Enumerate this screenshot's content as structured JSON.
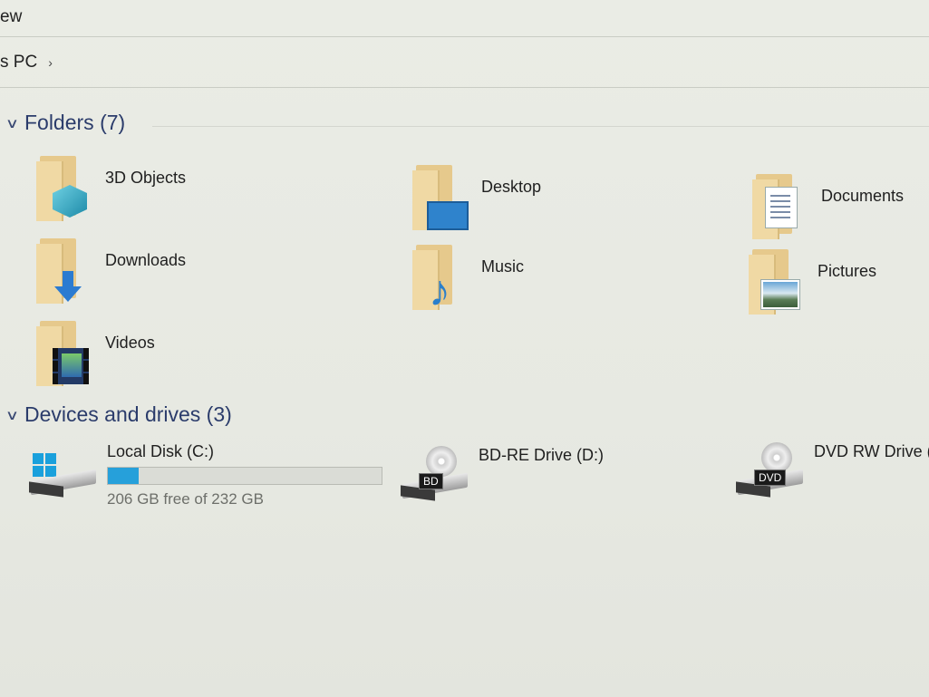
{
  "menu": {
    "fragment": "ew"
  },
  "address": {
    "text": "s PC",
    "chevron": "›"
  },
  "groups": {
    "folders": {
      "title": "Folders (7)",
      "caret": "∨"
    },
    "drives": {
      "title": "Devices and drives (3)",
      "caret": "∨"
    }
  },
  "folders": [
    {
      "label": "3D Objects",
      "icon": "3d-objects-folder-icon"
    },
    {
      "label": "Desktop",
      "icon": "desktop-folder-icon"
    },
    {
      "label": "Documents",
      "icon": "documents-folder-icon"
    },
    {
      "label": "Downloads",
      "icon": "downloads-folder-icon"
    },
    {
      "label": "Music",
      "icon": "music-folder-icon"
    },
    {
      "label": "Pictures",
      "icon": "pictures-folder-icon"
    },
    {
      "label": "Videos",
      "icon": "videos-folder-icon"
    }
  ],
  "drives": [
    {
      "name": "Local Disk (C:)",
      "free_text": "206 GB free of 232 GB",
      "used_fraction": 0.112,
      "icon": "hard-disk-icon",
      "bar_color": "#26a0da"
    },
    {
      "name": "BD-RE Drive (D:)",
      "badge": "BD",
      "icon": "bd-drive-icon"
    },
    {
      "name": "DVD RW Drive (E:)",
      "badge": "DVD",
      "icon": "dvd-drive-icon"
    }
  ]
}
